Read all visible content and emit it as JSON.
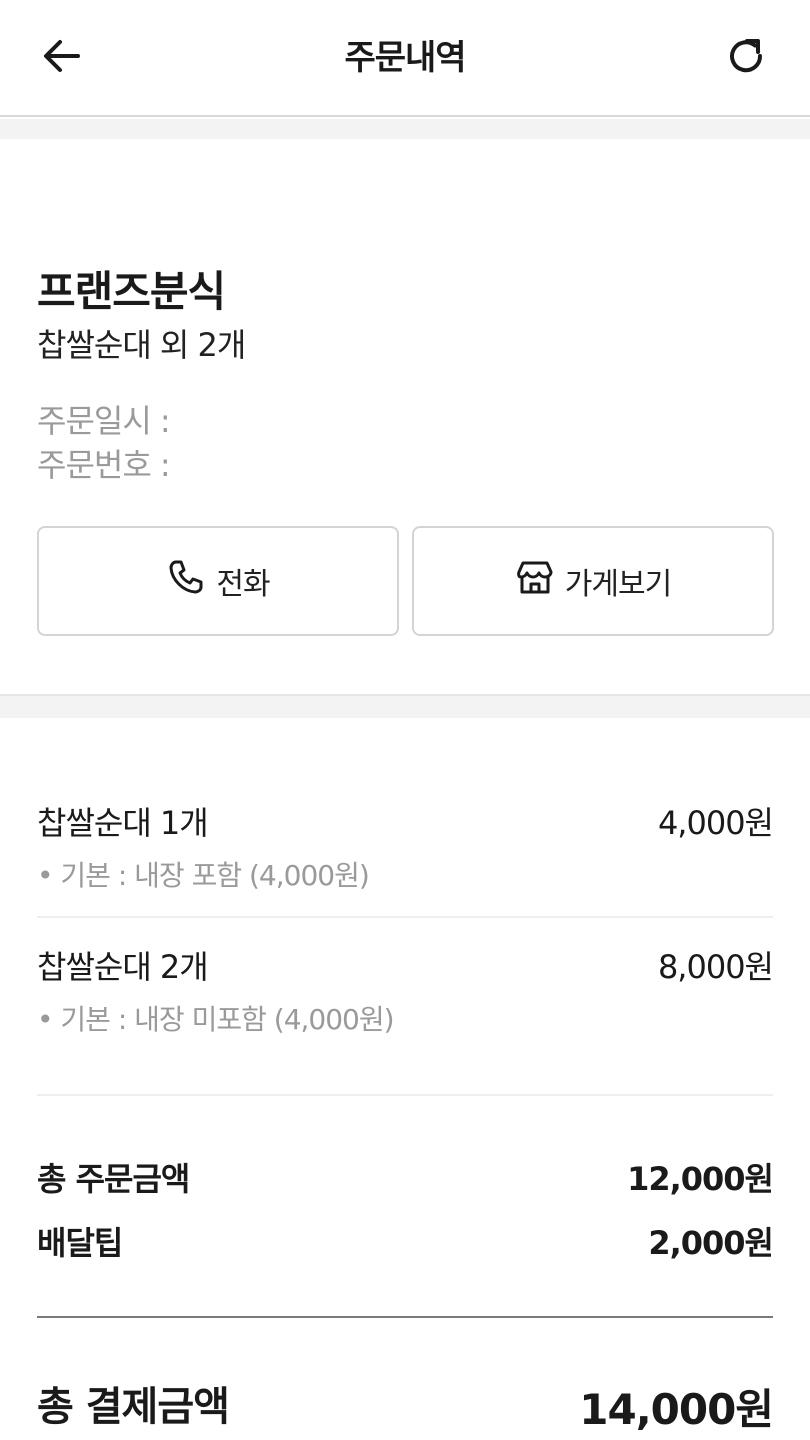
{
  "header": {
    "title": "주문내역",
    "back_icon": "arrow-left-icon",
    "refresh_icon": "refresh-icon"
  },
  "store": {
    "name": "프랜즈분식",
    "order_summary": "찹쌀순대 외 2개",
    "order_date_label": "주문일시 :",
    "order_number_label": "주문번호 :"
  },
  "actions": {
    "call_label": "전화",
    "call_icon": "phone-icon",
    "store_label": "가게보기",
    "store_icon": "store-icon"
  },
  "items": [
    {
      "name": "찹쌀순대 1개",
      "price": "4,000원",
      "option": "• 기본 : 내장 포함 (4,000원)"
    },
    {
      "name": "찹쌀순대 2개",
      "price": "8,000원",
      "option": "• 기본 : 내장 미포함 (4,000원)"
    }
  ],
  "summary": {
    "order_total_label": "총 주문금액",
    "order_total_value": "12,000원",
    "delivery_tip_label": "배달팁",
    "delivery_tip_value": "2,000원",
    "payment_total_label": "총 결제금액",
    "payment_total_value": "14,000원"
  }
}
